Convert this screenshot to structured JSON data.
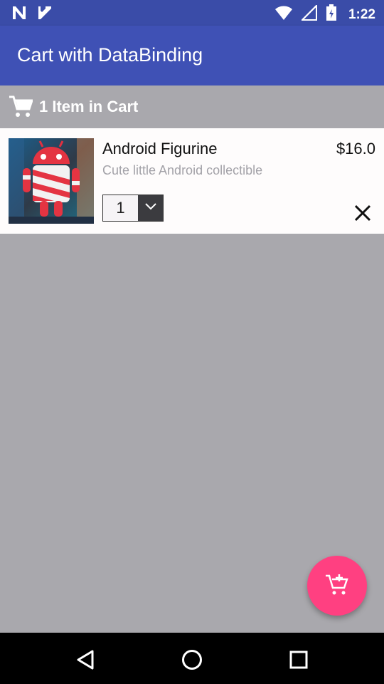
{
  "status_bar": {
    "time": "1:22",
    "icons": [
      "n-notification-icon",
      "check-notification-icon",
      "wifi-icon",
      "signal-icon",
      "battery-icon"
    ]
  },
  "app_bar": {
    "title": "Cart with DataBinding"
  },
  "cart_header": {
    "icon": "cart-icon",
    "count_text": "1 Item in Cart"
  },
  "items": [
    {
      "name": "Android Figurine",
      "description": "Cute little Android collectible",
      "price": "$16.0",
      "quantity": "1",
      "thumbnail": "android-figurine-image"
    }
  ],
  "fab": {
    "icon": "add-to-cart-icon"
  },
  "nav_bar": {
    "buttons": [
      "back-icon",
      "home-icon",
      "recents-icon"
    ]
  },
  "colors": {
    "primary": "#3f51b5",
    "primary_dark": "#3a4ca8",
    "accent": "#ff4081",
    "background": "#a9a8ad"
  }
}
